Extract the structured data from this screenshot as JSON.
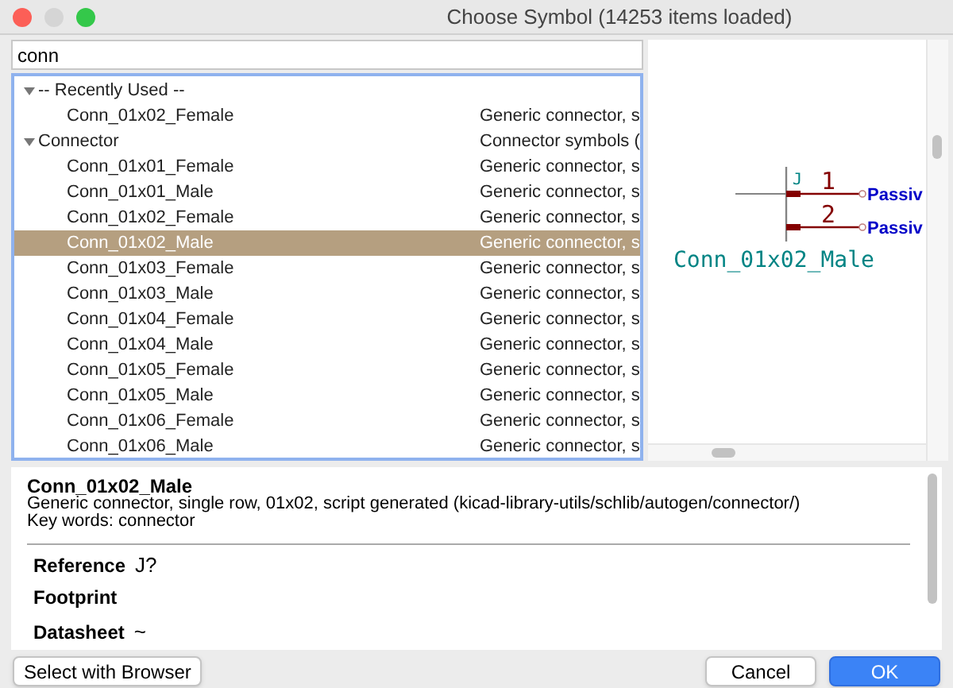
{
  "window": {
    "title": "Choose Symbol (14253 items loaded)"
  },
  "search": {
    "value": "conn"
  },
  "tree": [
    {
      "label": "-- Recently Used --",
      "expanded": true,
      "children": [
        {
          "label": "Conn_01x02_Female",
          "description": "Generic connector, s",
          "selected": false
        }
      ]
    },
    {
      "label": "Connector",
      "description": "Connector symbols (",
      "expanded": true,
      "children": [
        {
          "label": "Conn_01x01_Female",
          "description": "Generic connector, s",
          "selected": false
        },
        {
          "label": "Conn_01x01_Male",
          "description": "Generic connector, s",
          "selected": false
        },
        {
          "label": "Conn_01x02_Female",
          "description": "Generic connector, s",
          "selected": false
        },
        {
          "label": "Conn_01x02_Male",
          "description": "Generic connector, s",
          "selected": true
        },
        {
          "label": "Conn_01x03_Female",
          "description": "Generic connector, s",
          "selected": false
        },
        {
          "label": "Conn_01x03_Male",
          "description": "Generic connector, s",
          "selected": false
        },
        {
          "label": "Conn_01x04_Female",
          "description": "Generic connector, s",
          "selected": false
        },
        {
          "label": "Conn_01x04_Male",
          "description": "Generic connector, s",
          "selected": false
        },
        {
          "label": "Conn_01x05_Female",
          "description": "Generic connector, s",
          "selected": false
        },
        {
          "label": "Conn_01x05_Male",
          "description": "Generic connector, s",
          "selected": false
        },
        {
          "label": "Conn_01x06_Female",
          "description": "Generic connector, s",
          "selected": false
        },
        {
          "label": "Conn_01x06_Male",
          "description": "Generic connector, s",
          "selected": false
        }
      ]
    }
  ],
  "preview": {
    "reference": "J",
    "pins": [
      {
        "number": "1",
        "type": "Passiv"
      },
      {
        "number": "2",
        "type": "Passiv"
      }
    ],
    "value": "Conn_01x02_Male"
  },
  "details": {
    "name": "Conn_01x02_Male",
    "description": "Generic connector, single row, 01x02, script generated (kicad-library-utils/schlib/autogen/connector/)",
    "keywords": "Key words: connector",
    "reference_field": {
      "label": "Reference",
      "value": "J?"
    },
    "footprint_field": {
      "label": "Footprint"
    },
    "datasheet_field": {
      "label": "Datasheet",
      "value": "~"
    }
  },
  "buttons": [
    {
      "label": "Select with Browser",
      "kind": "normal"
    },
    {
      "label": "Cancel",
      "kind": "normal"
    },
    {
      "label": "OK",
      "kind": "default"
    }
  ]
}
